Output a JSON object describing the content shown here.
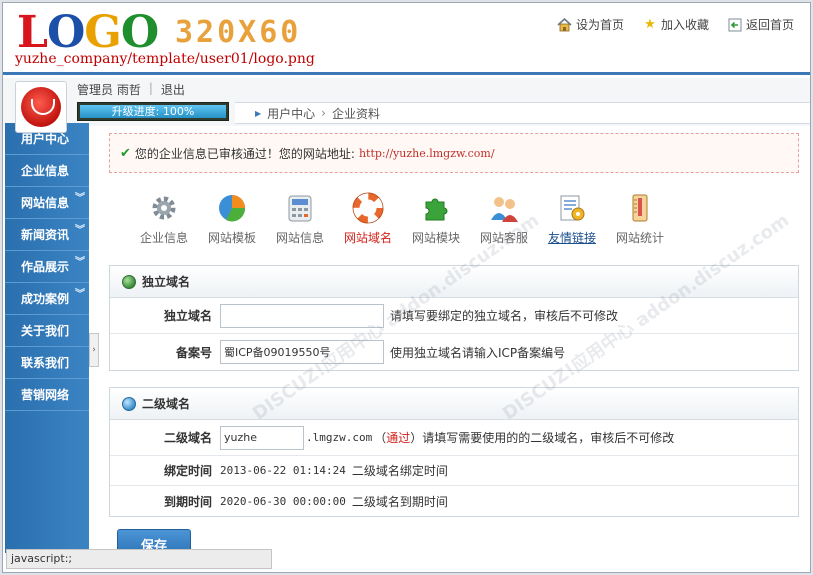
{
  "header": {
    "logo_part1": "L",
    "logo_part2": "O",
    "logo_part3": "G",
    "logo_part4": "O",
    "logo_size": "320X60",
    "logo_path": "yuzhe_company/template/user01/logo.png",
    "links": [
      {
        "label": "设为首页",
        "icon": "home-icon"
      },
      {
        "label": "加入收藏",
        "icon": "star-icon"
      },
      {
        "label": "返回首页",
        "icon": "back-icon"
      }
    ]
  },
  "user": {
    "role_name": "管理员 雨哲",
    "logout": "退出",
    "progress_label": "升级进度: 100%",
    "progress_value": 100
  },
  "breadcrumb": [
    "用户中心",
    "企业资料"
  ],
  "sidebar": {
    "items": [
      {
        "label": "用户中心",
        "chevron": false
      },
      {
        "label": "企业信息",
        "chevron": false
      },
      {
        "label": "网站信息",
        "chevron": true
      },
      {
        "label": "新闻资讯",
        "chevron": true
      },
      {
        "label": "作品展示",
        "chevron": true
      },
      {
        "label": "成功案例",
        "chevron": true
      },
      {
        "label": "关于我们",
        "chevron": false
      },
      {
        "label": "联系我们",
        "chevron": false
      },
      {
        "label": "营销网络",
        "chevron": false
      }
    ]
  },
  "notice": {
    "text": "您的企业信息已审核通过！您的网站地址:",
    "url": "http://yuzhe.lmgzw.com/"
  },
  "tools": [
    {
      "label": "企业信息",
      "icon": "gear-icon",
      "color": "#7f8b95"
    },
    {
      "label": "网站模板",
      "icon": "pie-chart-icon",
      "color": "#f28c1e"
    },
    {
      "label": "网站信息",
      "icon": "calculator-icon",
      "color": "#9aa3ab"
    },
    {
      "label": "网站域名",
      "icon": "lifebuoy-icon",
      "color": "#e8672a"
    },
    {
      "label": "网站模块",
      "icon": "puzzle-icon",
      "color": "#3aa43a"
    },
    {
      "label": "网站客服",
      "icon": "users-icon",
      "color": "#d0453b"
    },
    {
      "label": "友情链接",
      "icon": "settings-page-icon",
      "color": "#5b8fd1"
    },
    {
      "label": "网站统计",
      "icon": "thermometer-icon",
      "color": "#d79a3a"
    }
  ],
  "independent_domain": {
    "title": "独立域名",
    "domain_label": "独立域名",
    "domain_value": "",
    "domain_hint": "请填写要绑定的独立域名，审核后不可修改",
    "icp_label": "备案号",
    "icp_value": "蜀ICP备09019550号",
    "icp_hint": "使用独立域名请输入ICP备案编号"
  },
  "sub_domain": {
    "title": "二级域名",
    "domain_label": "二级域名",
    "domain_value": "yuzhe",
    "domain_suffix": ".lmgzw.com",
    "status_open": "（",
    "status": "通过",
    "status_close": "）",
    "domain_hint": "请填写需要使用的的二级域名，审核后不可修改",
    "bind_label": "绑定时间",
    "bind_value": "2013-06-22 01:14:24",
    "bind_hint": "二级域名绑定时间",
    "expire_label": "到期时间",
    "expire_value": "2020-06-30 00:00:00",
    "expire_hint": "二级域名到期时间"
  },
  "save_label": "保存",
  "status_bar": "javascript:;",
  "watermarks": [
    "DISCUZ!应用中心 addon.discuz.com",
    "DISCUZ!应用中心 addon.discuz.com"
  ]
}
